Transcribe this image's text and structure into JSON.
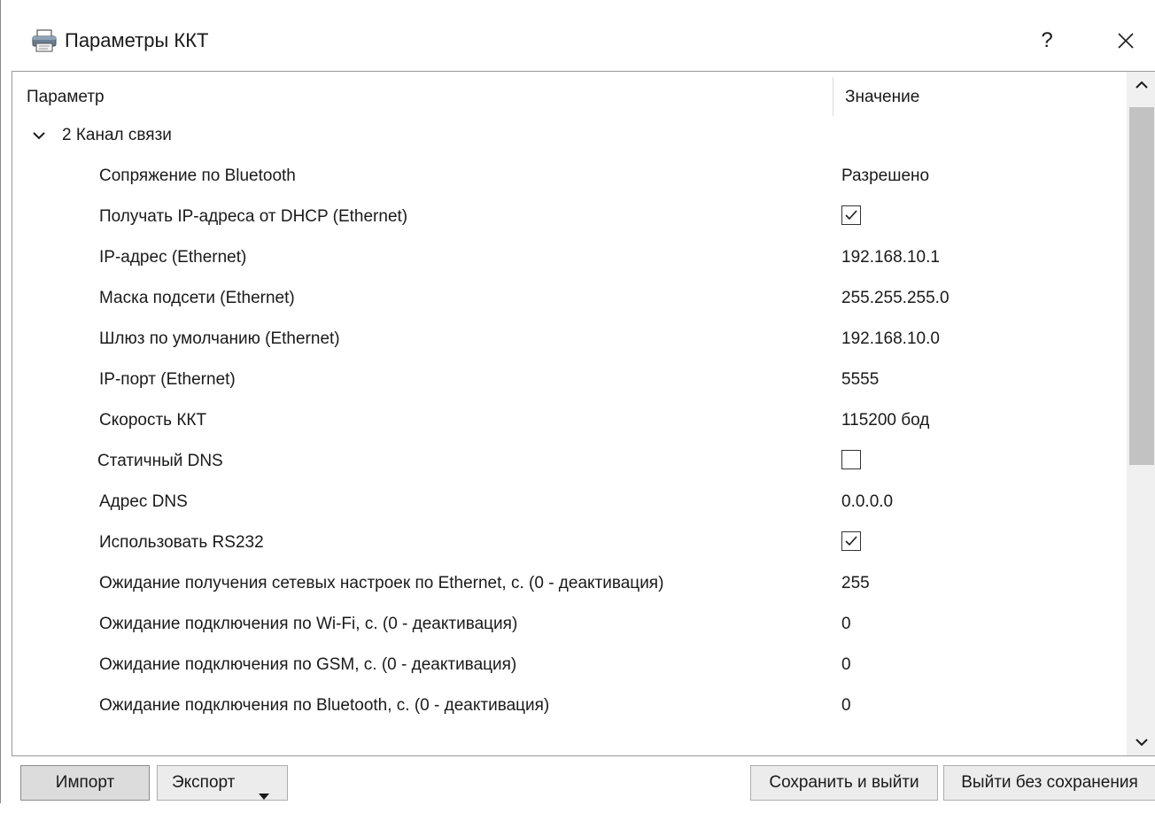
{
  "window": {
    "title": "Параметры ККТ",
    "help_label": "?",
    "close_label": "×"
  },
  "table": {
    "col_param": "Параметр",
    "col_value": "Значение",
    "group": {
      "label": "2 Канал связи",
      "expanded": true
    },
    "rows": [
      {
        "label": "Сопряжение по Bluetooth",
        "type": "text",
        "value": "Разрешено"
      },
      {
        "label": "Получать IP-адреса от DHCP (Ethernet)",
        "type": "checkbox",
        "checked": true
      },
      {
        "label": "IP-адрес (Ethernet)",
        "type": "text",
        "value": "192.168.10.1"
      },
      {
        "label": "Маска подсети (Ethernet)",
        "type": "text",
        "value": "255.255.255.0"
      },
      {
        "label": "Шлюз по умолчанию (Ethernet)",
        "type": "text",
        "value": "192.168.10.0"
      },
      {
        "label": "IP-порт (Ethernet)",
        "type": "text",
        "value": "5555"
      },
      {
        "label": "Скорость ККТ",
        "type": "text",
        "value": "115200 бод"
      },
      {
        "label": "Статичный DNS",
        "type": "checkbox",
        "checked": false
      },
      {
        "label": "Адрес DNS",
        "type": "text",
        "value": "0.0.0.0"
      },
      {
        "label": "Использовать RS232",
        "type": "checkbox",
        "checked": true
      },
      {
        "label": "Ожидание получения сетевых настроек по Ethernet, с. (0 - деактивация)",
        "type": "text",
        "value": "255"
      },
      {
        "label": "Ожидание подключения по Wi-Fi, с. (0 - деактивация)",
        "type": "text",
        "value": "0"
      },
      {
        "label": "Ожидание подключения по GSM, с. (0 - деактивация)",
        "type": "text",
        "value": "0"
      },
      {
        "label": "Ожидание подключения по Bluetooth, с. (0 - деактивация)",
        "type": "text",
        "value": "0"
      }
    ]
  },
  "footer": {
    "import_label": "Импорт",
    "export_label": "Экспорт",
    "save_label": "Сохранить и выйти",
    "nosave_label": "Выйти без сохранения"
  },
  "icons": {
    "title_icon": "printer-icon",
    "group_toggle": "chevron-down-icon",
    "scroll_up": "chevron-up-icon",
    "scroll_down": "chevron-down-icon",
    "export_dropdown": "triangle-down-icon"
  }
}
